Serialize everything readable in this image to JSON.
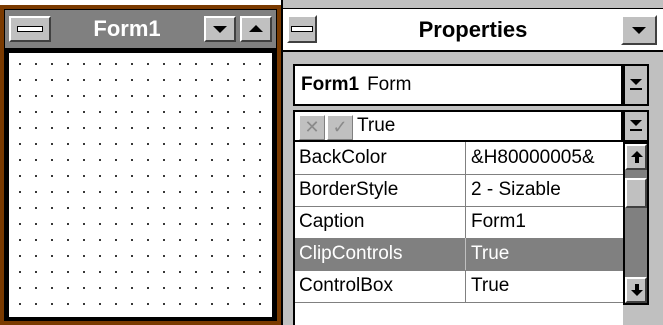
{
  "colors": {
    "form_border": "#7a3a00",
    "title_inactive": "#808080",
    "selected_row": "#808080",
    "face": "#c0c0c0"
  },
  "form_window": {
    "title": "Form1",
    "icons": [
      "system-menu-icon",
      "minimize-arrow-icon",
      "maximize-arrow-icon"
    ]
  },
  "properties_window": {
    "title": "Properties",
    "object_combo": {
      "name": "Form1",
      "type": "Form"
    },
    "edit_box": {
      "value": "True",
      "icons": [
        "cancel-x-icon",
        "confirm-check-icon"
      ]
    },
    "rows": [
      {
        "name": "BackColor",
        "value": "&H80000005&"
      },
      {
        "name": "BorderStyle",
        "value": "2 - Sizable"
      },
      {
        "name": "Caption",
        "value": "Form1"
      },
      {
        "name": "ClipControls",
        "value": "True",
        "selected": true
      },
      {
        "name": "ControlBox",
        "value": "True"
      }
    ]
  }
}
